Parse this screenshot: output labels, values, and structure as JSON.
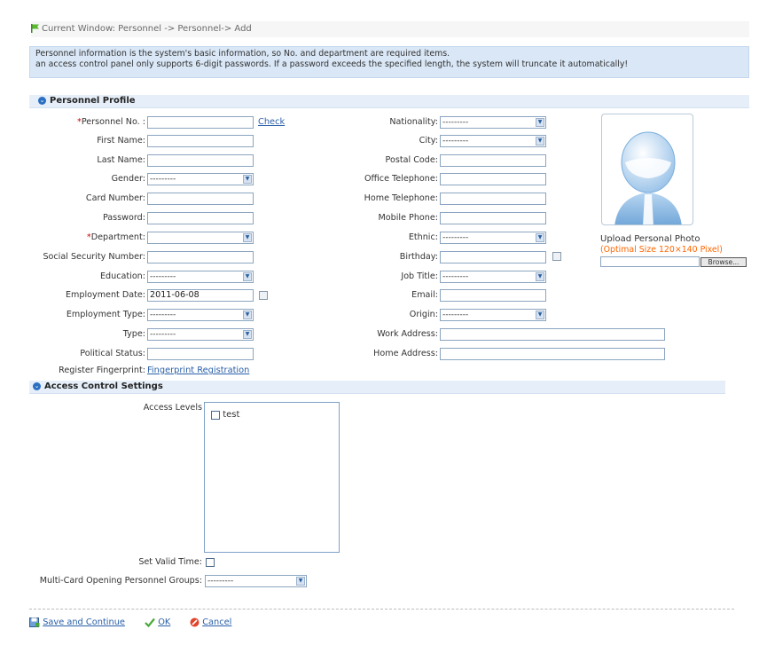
{
  "breadcrumb": "Current Window: Personnel -> Personnel-> Add",
  "notice": {
    "line1": "Personnel information is the system's basic information, so No. and department are required items.",
    "line2": "an access control panel only supports 6-digit passwords. If a password exceeds the specified length, the system will truncate it automatically!"
  },
  "sections": {
    "profile": "Personnel Profile",
    "access": "Access Control Settings"
  },
  "left_fields": {
    "personnel_no": {
      "label": "Personnel No. :",
      "value": ""
    },
    "check_link": "Check",
    "first_name": {
      "label": "First Name:",
      "value": ""
    },
    "last_name": {
      "label": "Last Name:",
      "value": ""
    },
    "gender": {
      "label": "Gender:",
      "value": "---------"
    },
    "card_number": {
      "label": "Card Number:",
      "value": ""
    },
    "password": {
      "label": "Password:",
      "value": ""
    },
    "department": {
      "label": "Department:",
      "value": ""
    },
    "ssn": {
      "label": "Social Security Number:",
      "value": ""
    },
    "education": {
      "label": "Education:",
      "value": "---------"
    },
    "employment_date": {
      "label": "Employment Date:",
      "value": "2011-06-08"
    },
    "employment_type": {
      "label": "Employment Type:",
      "value": "---------"
    },
    "type": {
      "label": "Type:",
      "value": "---------"
    },
    "political_status": {
      "label": "Political Status:",
      "value": ""
    },
    "fingerprint": {
      "label": "Register Fingerprint:",
      "link": "Fingerprint Registration"
    }
  },
  "right_fields": {
    "nationality": {
      "label": "Nationality:",
      "value": "---------"
    },
    "city": {
      "label": "City:",
      "value": "---------"
    },
    "postal_code": {
      "label": "Postal Code:",
      "value": ""
    },
    "office_telephone": {
      "label": "Office Telephone:",
      "value": ""
    },
    "home_telephone": {
      "label": "Home Telephone:",
      "value": ""
    },
    "mobile_phone": {
      "label": "Mobile Phone:",
      "value": ""
    },
    "ethnic": {
      "label": "Ethnic:",
      "value": "---------"
    },
    "birthday": {
      "label": "Birthday:",
      "value": ""
    },
    "job_title": {
      "label": "Job Title:",
      "value": "---------"
    },
    "email": {
      "label": "Email:",
      "value": ""
    },
    "origin": {
      "label": "Origin:",
      "value": "---------"
    },
    "work_address": {
      "label": "Work Address:",
      "value": ""
    },
    "home_address": {
      "label": "Home Address:",
      "value": ""
    }
  },
  "photo": {
    "upload_label": "Upload Personal Photo",
    "optimal_size": "(Optimal Size 120×140 Pixel)",
    "browse": "Browse..."
  },
  "access": {
    "levels_label": "Access Levels",
    "levels": [
      "test"
    ],
    "valid_time_label": "Set Valid Time:",
    "multicard_label": "Multi-Card Opening Personnel Groups:",
    "multicard_value": "---------"
  },
  "actions": {
    "save_continue": "Save and Continue",
    "ok": "OK",
    "cancel": "Cancel"
  },
  "colors": {
    "accent": "#2a6fc2",
    "required": "#cc0000",
    "hint": "#ff6600"
  }
}
